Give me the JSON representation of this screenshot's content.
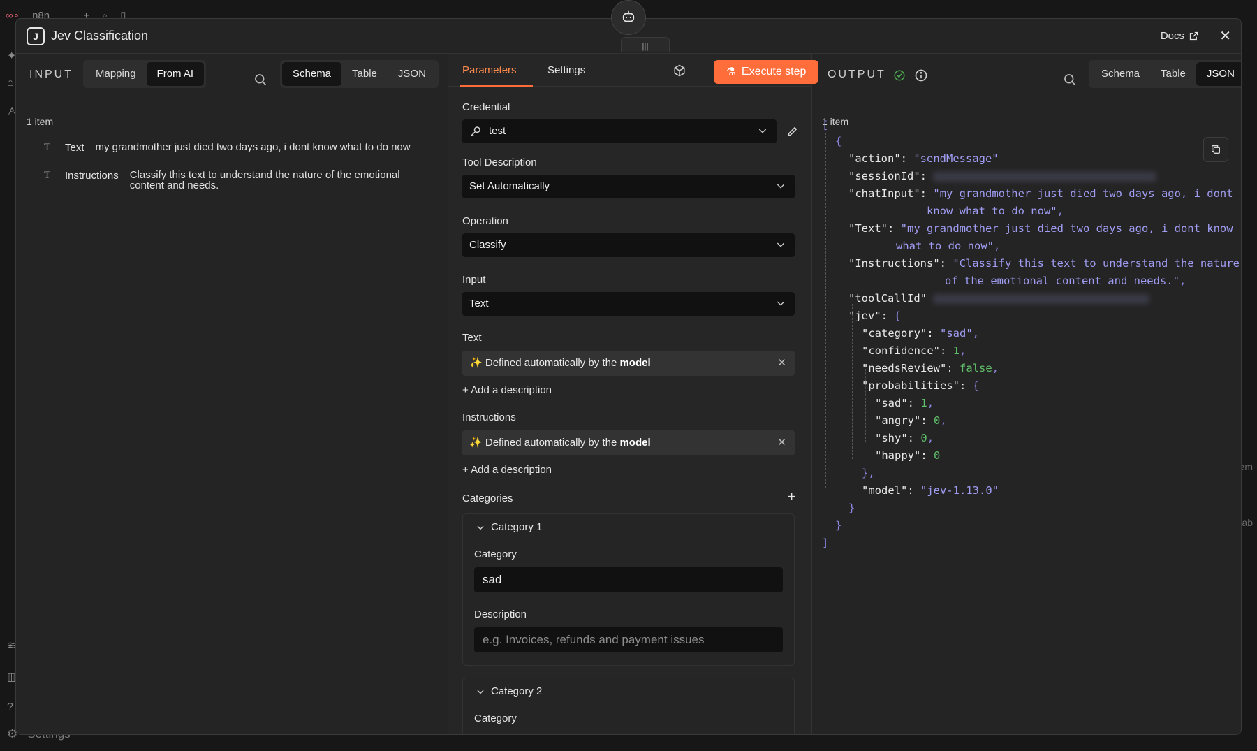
{
  "background": {
    "app_name": "n8n",
    "settings_label": "Settings",
    "right_hint_1": "em",
    "right_hint_2": "lab"
  },
  "modal": {
    "title": "Jev Classification",
    "node_icon_label": "J",
    "docs_label": "Docs"
  },
  "input_panel": {
    "title": "INPUT",
    "mode_options": [
      "Mapping",
      "From AI"
    ],
    "mode_selected": "From AI",
    "view_options": [
      "Schema",
      "Table",
      "JSON"
    ],
    "view_selected": "Schema",
    "item_count": "1 item",
    "fields": [
      {
        "type_icon": "T",
        "key": "Text",
        "value": "my grandmother just died two days ago, i dont know what to do now"
      },
      {
        "type_icon": "T",
        "key": "Instructions",
        "value": "Classify this text to understand the nature of the emotional",
        "value_line2": "content and needs."
      }
    ]
  },
  "params_panel": {
    "tabs": [
      "Parameters",
      "Settings"
    ],
    "active_tab": "Parameters",
    "execute_label": "Execute step",
    "credential": {
      "label": "Credential",
      "value": "test"
    },
    "tool_description": {
      "label": "Tool Description",
      "value": "Set Automatically"
    },
    "operation": {
      "label": "Operation",
      "value": "Classify"
    },
    "input": {
      "label": "Input",
      "value": "Text"
    },
    "text": {
      "label": "Text",
      "auto_prefix": "Defined automatically by the ",
      "auto_bold": "model",
      "add_description": "+ Add a description"
    },
    "instructions": {
      "label": "Instructions",
      "auto_prefix": "Defined automatically by the ",
      "auto_bold": "model",
      "add_description": "+ Add a description"
    },
    "categories": {
      "label": "Categories",
      "items": [
        {
          "title": "Category 1",
          "category_label": "Category",
          "category_value": "sad",
          "description_label": "Description",
          "description_placeholder": "e.g. Invoices, refunds and payment issues"
        },
        {
          "title": "Category 2",
          "category_label": "Category"
        }
      ]
    }
  },
  "output_panel": {
    "title": "OUTPUT",
    "view_options": [
      "Schema",
      "Table",
      "JSON"
    ],
    "view_selected": "JSON",
    "item_count": "1 item",
    "json": {
      "action": "\"sendMessage\"",
      "chatInput_1": "\"my grandmother just died two days ago, i dont",
      "chatInput_2": "know what to do now\"",
      "Text_1": "\"my grandmother just died two days ago, i dont know",
      "Text_2": "what to do now\"",
      "Instructions_1": "\"Classify this text to understand the nature",
      "Instructions_2": "of the emotional content and needs.\"",
      "category": "\"sad\"",
      "confidence": "1",
      "needsReview": "false",
      "prob_sad": "1",
      "prob_angry": "0",
      "prob_shy": "0",
      "prob_happy": "0",
      "model": "\"jev-1.13.0\""
    }
  },
  "colors": {
    "accent": "#ff6d3a",
    "string": "#9f9cf2",
    "number": "#5fbf6a",
    "success": "#4caf50"
  }
}
